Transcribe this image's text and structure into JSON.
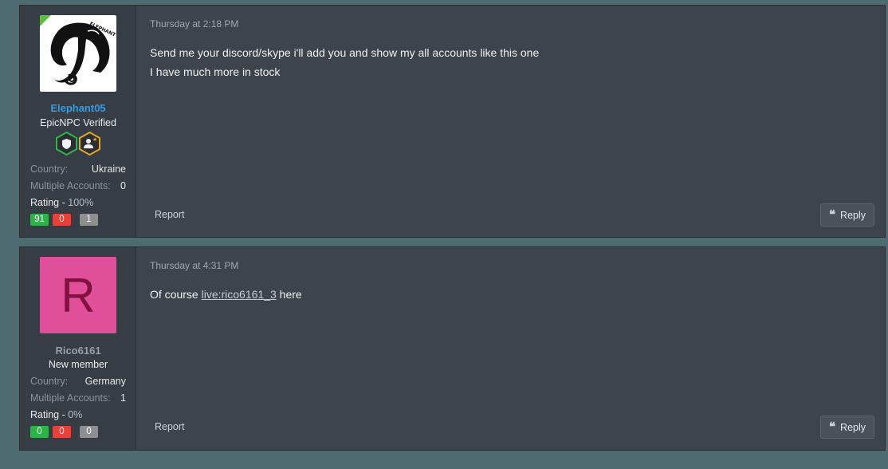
{
  "posts": [
    {
      "user": {
        "name": "Elephant05",
        "title": "EpicNPC Verified",
        "country_label": "Country:",
        "country": "Ukraine",
        "multi_label": "Multiple Accounts:",
        "multi": "0",
        "rating_label": "Rating -",
        "rating": "100%",
        "positive": "91",
        "negative": "0",
        "neutral": "1",
        "avatar_watermark": "ELEPHANT"
      },
      "date": "Thursday at 2:18 PM",
      "message_line1": "Send me your discord/skype i'll add you and show my all accounts like this one",
      "message_line2": "I have much more in stock",
      "report": "Report",
      "reply": "Reply"
    },
    {
      "user": {
        "name": "Rico6161",
        "title": "New member",
        "avatar_letter": "R",
        "country_label": "Country:",
        "country": "Germany",
        "multi_label": "Multiple Accounts:",
        "multi": "1",
        "rating_label": "Rating -",
        "rating": "0%",
        "positive": "0",
        "negative": "0",
        "neutral": "0"
      },
      "date": "Thursday at 4:31 PM",
      "message_before": "Of course",
      "message_link": "live:rico6161_3",
      "message_after": "here",
      "report": "Report",
      "reply": "Reply"
    }
  ],
  "colors": {
    "background": "#4e6b72",
    "post_bg": "#3e444c",
    "username_verified": "#2f9de6",
    "avatar_letter_bg": "#e0509a",
    "positive": "#2eb34b",
    "negative": "#e8403a",
    "neutral": "#8f8f8f"
  },
  "icons": {
    "badge1": "shield-badge-icon",
    "badge2": "user-star-badge-icon",
    "reply": "quote-icon"
  }
}
